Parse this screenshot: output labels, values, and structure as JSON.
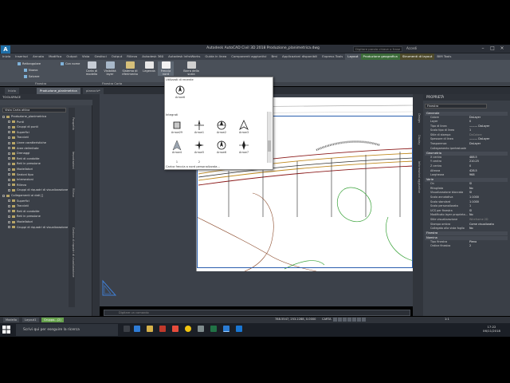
{
  "window": {
    "app_logo": "A",
    "title": "Autodesk AutoCAD Civil 3D 2018   Produzione_planimetrica.dwg",
    "search_placeholder": "Digitare parola chiave o frase",
    "account": "Accedi"
  },
  "ribbon_tabs": [
    "Inizio",
    "Inserisci",
    "Annota",
    "Modifica",
    "Output",
    "Vista",
    "Gestisci",
    "Output",
    "Rilievo",
    "Autodesk 360",
    "Autodesk InfraWorks",
    "Guida in linea",
    "Componenti aggiuntivi",
    "Bmi",
    "Applicazioni disponibili",
    "Express Tools",
    "Layout",
    "Produzione geografica",
    "Strumenti di layout",
    "BIM Tools"
  ],
  "ribbon": {
    "small_buttons": [
      "Rettangolare",
      "Con nome",
      "Nuovo",
      "Salvare"
    ],
    "big_buttons": [
      "Carta di modello",
      "Visibilità layer",
      "Sistema di riferimento",
      "Legenda",
      "Freccia nord",
      "Barra della scala"
    ],
    "panels": [
      "Finestra",
      "Finestra Carta",
      "Elementi di carta"
    ]
  },
  "doc_tabs": [
    "Inizio",
    "Produzione_planimetrica",
    "pianociv*"
  ],
  "toolspace": {
    "title": "TOOLSPACE",
    "view_select": "Vista Carta attiva",
    "tree": [
      {
        "label": "Produzione_planimetrica",
        "level": 0
      },
      {
        "label": "Punti",
        "level": 1
      },
      {
        "label": "Gruppi di punti",
        "level": 1
      },
      {
        "label": "Superfici",
        "level": 1
      },
      {
        "label": "Tracciati",
        "level": 1
      },
      {
        "label": "Linee caratteristiche",
        "level": 1
      },
      {
        "label": "Aree delimitate",
        "level": 1
      },
      {
        "label": "Drenaggi",
        "level": 1
      },
      {
        "label": "Reti di condotte",
        "level": 1
      },
      {
        "label": "Reti in pressione",
        "level": 1
      },
      {
        "label": "Modellatori",
        "level": 1
      },
      {
        "label": "Sezioni tipo",
        "level": 1
      },
      {
        "label": "Intersezioni",
        "level": 1
      },
      {
        "label": "Rilievo",
        "level": 1
      },
      {
        "label": "Gruppi di riquadri di visualizzazione",
        "level": 1
      },
      {
        "label": "Collegamenti ai dati []",
        "level": 0
      },
      {
        "label": "Superfici",
        "level": 1
      },
      {
        "label": "Tracciati",
        "level": 1
      },
      {
        "label": "Reti di condotte",
        "level": 1
      },
      {
        "label": "Reti in pressione",
        "level": 1
      },
      {
        "label": "Modellatori",
        "level": 1
      },
      {
        "label": "Gruppi di riquadri di visualizzazione",
        "level": 1
      }
    ],
    "vtabs": [
      "Prospetto",
      "Impostazioni",
      "Rilievo",
      "Gestore di riquadri di visualizzazione"
    ]
  },
  "flyout": {
    "recent_label": "Utilizzati di recente",
    "category_label": "Integrati",
    "bottom_link": "Carica freccia a nord personalizzata...",
    "recent": [
      "Arrow6"
    ],
    "items": [
      "Arrow29",
      "Arrow1",
      "Arrow2",
      "Arrow3",
      "Arrow4",
      "Arrow5",
      "Arrow6",
      "Arrow7"
    ],
    "partial_labels": [
      "1",
      "2"
    ]
  },
  "command": {
    "placeholder": "Digitare un comando"
  },
  "layout_tabs": [
    "Modello",
    "Layout1",
    "Gruppo...(2)"
  ],
  "status": {
    "coords": "788.5547, 253.2288, 0.0000",
    "space": "CARTA",
    "scale": "1:1"
  },
  "properties": {
    "title": "PROPRIETÀ",
    "selection": "Finestra",
    "vtabs": [
      "Design",
      "Display",
      "Informazioni aggiuntive"
    ],
    "sections": [
      {
        "name": "Generale",
        "rows": [
          {
            "k": "Colore",
            "v": "DaLayer"
          },
          {
            "k": "Layer",
            "v": "0"
          },
          {
            "k": "Tipo di linea",
            "v": "——— DaLayer"
          },
          {
            "k": "Scala tipo di linea",
            "v": "1"
          },
          {
            "k": "Stile di stampa",
            "v": "DaColore",
            "dim": true
          },
          {
            "k": "Spessore di linea",
            "v": "——— DaLayer"
          },
          {
            "k": "Trasparenza",
            "v": "DaLayer"
          },
          {
            "k": "Collegamento ipertestuale",
            "v": ""
          }
        ]
      },
      {
        "name": "Geometria",
        "rows": [
          {
            "k": "X centro",
            "v": "488.5"
          },
          {
            "k": "Y centro",
            "v": "210.25"
          },
          {
            "k": "Z centro",
            "v": "0"
          },
          {
            "k": "Altezza",
            "v": "428.5"
          },
          {
            "k": "Larghezza",
            "v": "968"
          }
        ]
      },
      {
        "name": "Varie",
        "rows": [
          {
            "k": "On",
            "v": "Sì"
          },
          {
            "k": "Ritagliata",
            "v": "No"
          },
          {
            "k": "Visualizzazione bloccata",
            "v": "Sì"
          },
          {
            "k": "Scala annotativa",
            "v": "1:1000"
          },
          {
            "k": "Scala standard",
            "v": "1:1000"
          },
          {
            "k": "Scala personalizzata",
            "v": "1"
          },
          {
            "k": "UCS per finestra",
            "v": "Sì"
          },
          {
            "k": "Modificato layer proprieta...",
            "v": "No"
          },
          {
            "k": "Stile visualizzazione",
            "v": "Wireframe 2D",
            "dim": true
          },
          {
            "k": "Stampa ombra",
            "v": "Come visualizzata"
          },
          {
            "k": "Collegato alla vista foglio",
            "v": "No"
          }
        ]
      },
      {
        "name": "Finestra",
        "rows": []
      },
      {
        "name": "Nomina",
        "rows": [
          {
            "k": "Tipo finestra",
            "v": "Pieno"
          },
          {
            "k": "Ordine finestra",
            "v": "2"
          }
        ]
      }
    ]
  },
  "taskbar": {
    "search_placeholder": "Scrivi qui per eseguire la ricerca",
    "time": "17:22",
    "date": "06/11/2018"
  },
  "colors": {
    "ribbon_bg": "#4a5059",
    "panel_bg": "#3a3f47",
    "accent_blue": "#1f6fa8",
    "terrain_line": "#3aa33a",
    "road_line": "#8b1a1a",
    "active_layout_tab": "#65a04b"
  }
}
